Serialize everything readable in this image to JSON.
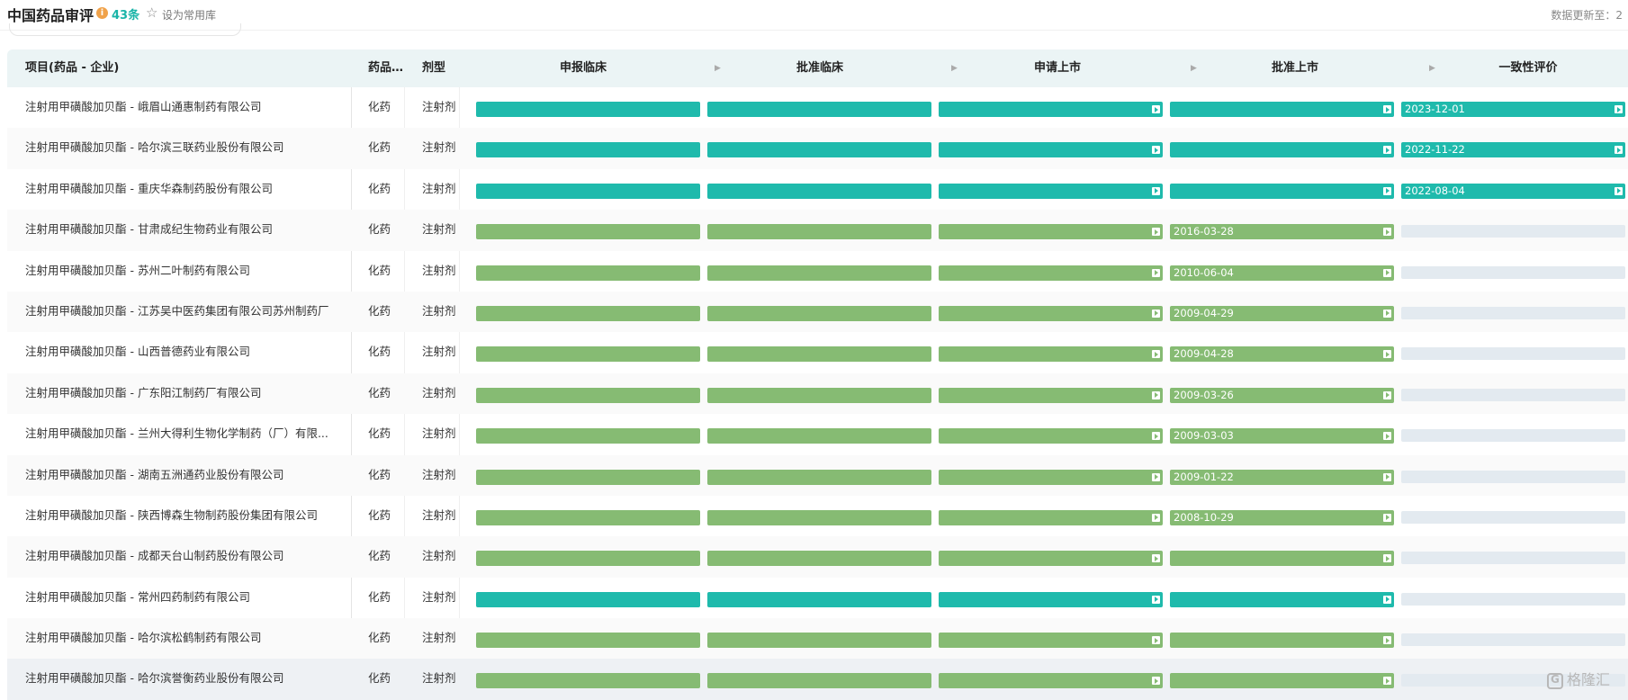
{
  "header": {
    "title": "中国药品审评",
    "info_icon": "i",
    "count": "43条",
    "favorite_label": "设为常用库",
    "updated_label": "数据更新至：2"
  },
  "table": {
    "columns": {
      "project": "项目(药品 - 企业)",
      "drug_type": "药品类型",
      "dosage_form": "剂型",
      "stages": [
        "申报临床",
        "批准临床",
        "申请上市",
        "批准上市",
        "一致性评价"
      ]
    },
    "rows": [
      {
        "name": "注射用甲磺酸加贝酯 - 峨眉山通惠制药有限公司",
        "type": "化药",
        "form": "注射剂",
        "color": "teal",
        "filled": 5,
        "dates": [
          "",
          "",
          "",
          "",
          "2023-12-01"
        ]
      },
      {
        "name": "注射用甲磺酸加贝酯 - 哈尔滨三联药业股份有限公司",
        "type": "化药",
        "form": "注射剂",
        "color": "teal",
        "filled": 5,
        "dates": [
          "",
          "",
          "",
          "",
          "2022-11-22"
        ]
      },
      {
        "name": "注射用甲磺酸加贝酯 - 重庆华森制药股份有限公司",
        "type": "化药",
        "form": "注射剂",
        "color": "teal",
        "filled": 5,
        "dates": [
          "",
          "",
          "",
          "",
          "2022-08-04"
        ]
      },
      {
        "name": "注射用甲磺酸加贝酯 - 甘肃成纪生物药业有限公司",
        "type": "化药",
        "form": "注射剂",
        "color": "green",
        "filled": 4,
        "dates": [
          "",
          "",
          "",
          "2016-03-28",
          ""
        ]
      },
      {
        "name": "注射用甲磺酸加贝酯 - 苏州二叶制药有限公司",
        "type": "化药",
        "form": "注射剂",
        "color": "green",
        "filled": 4,
        "dates": [
          "",
          "",
          "",
          "2010-06-04",
          ""
        ]
      },
      {
        "name": "注射用甲磺酸加贝酯 - 江苏吴中医药集团有限公司苏州制药厂",
        "type": "化药",
        "form": "注射剂",
        "color": "green",
        "filled": 4,
        "dates": [
          "",
          "",
          "",
          "2009-04-29",
          ""
        ]
      },
      {
        "name": "注射用甲磺酸加贝酯 - 山西普德药业有限公司",
        "type": "化药",
        "form": "注射剂",
        "color": "green",
        "filled": 4,
        "dates": [
          "",
          "",
          "",
          "2009-04-28",
          ""
        ]
      },
      {
        "name": "注射用甲磺酸加贝酯 - 广东阳江制药厂有限公司",
        "type": "化药",
        "form": "注射剂",
        "color": "green",
        "filled": 4,
        "dates": [
          "",
          "",
          "",
          "2009-03-26",
          ""
        ]
      },
      {
        "name": "注射用甲磺酸加贝酯 - 兰州大得利生物化学制药（厂）有限...",
        "type": "化药",
        "form": "注射剂",
        "color": "green",
        "filled": 4,
        "dates": [
          "",
          "",
          "",
          "2009-03-03",
          ""
        ]
      },
      {
        "name": "注射用甲磺酸加贝酯 - 湖南五洲通药业股份有限公司",
        "type": "化药",
        "form": "注射剂",
        "color": "green",
        "filled": 4,
        "dates": [
          "",
          "",
          "",
          "2009-01-22",
          ""
        ]
      },
      {
        "name": "注射用甲磺酸加贝酯 - 陕西博森生物制药股份集团有限公司",
        "type": "化药",
        "form": "注射剂",
        "color": "green",
        "filled": 4,
        "dates": [
          "",
          "",
          "",
          "2008-10-29",
          ""
        ]
      },
      {
        "name": "注射用甲磺酸加贝酯 - 成都天台山制药股份有限公司",
        "type": "化药",
        "form": "注射剂",
        "color": "green",
        "filled": 4,
        "dates": [
          "",
          "",
          "",
          "",
          ""
        ]
      },
      {
        "name": "注射用甲磺酸加贝酯 - 常州四药制药有限公司",
        "type": "化药",
        "form": "注射剂",
        "color": "teal",
        "filled": 4,
        "dates": [
          "",
          "",
          "",
          "",
          ""
        ]
      },
      {
        "name": "注射用甲磺酸加贝酯 - 哈尔滨松鹤制药有限公司",
        "type": "化药",
        "form": "注射剂",
        "color": "green",
        "filled": 4,
        "dates": [
          "",
          "",
          "",
          "",
          ""
        ]
      },
      {
        "name": "注射用甲磺酸加贝酯 - 哈尔滨誉衡药业股份有限公司",
        "type": "化药",
        "form": "注射剂",
        "color": "green",
        "filled": 4,
        "dates": [
          "",
          "",
          "",
          "",
          ""
        ]
      }
    ]
  },
  "watermark": "格隆汇",
  "colors": {
    "teal": "#1fbaac",
    "green": "#86bb73",
    "empty": "#e3eaf0",
    "accent": "#1ab4a8"
  }
}
